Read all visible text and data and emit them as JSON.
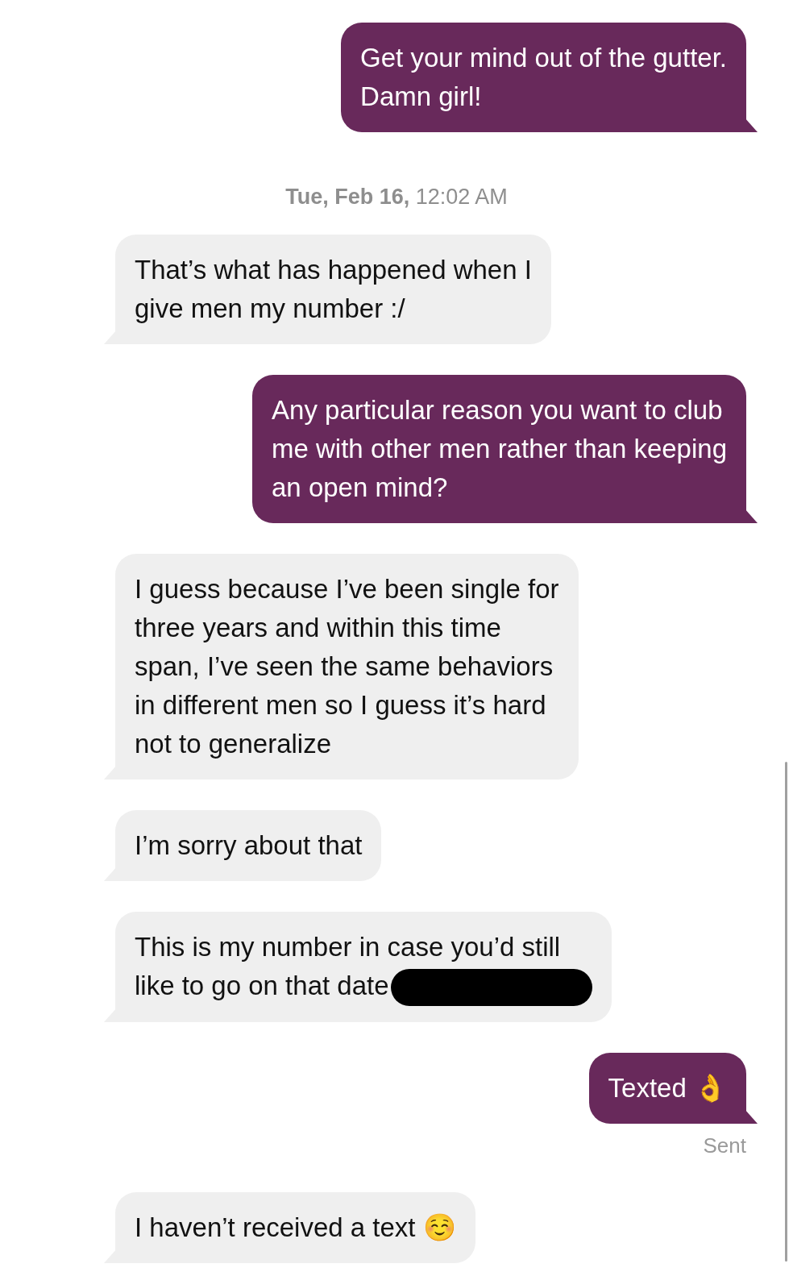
{
  "messages": [
    {
      "kind": "sent",
      "text": "Get your mind out of the gutter.\nDamn girl!"
    },
    {
      "kind": "timestamp",
      "text": "**Tue, Feb 16,** 12:02 AM"
    },
    {
      "kind": "received",
      "text": " That’s what has happened when I\ngive men my number :/"
    },
    {
      "kind": "sent",
      "text": "Any particular reason you want to club\nme with other men rather than keeping\nan open mind?"
    },
    {
      "kind": "received",
      "text": "I guess because I’ve been single for\nthree years and within this time\nspan, I’ve seen the same behaviors\nin different men so I guess it’s hard\nnot to generalize"
    },
    {
      "kind": "received",
      "text": "I’m sorry about that"
    },
    {
      "kind": "received",
      "text": "This is my number in case you’d still\nlike to go on that date",
      "redacted": true
    },
    {
      "kind": "sent",
      "text": "Texted 👌"
    },
    {
      "kind": "status",
      "text": "Sent"
    },
    {
      "kind": "received",
      "text": "I haven’t received a text ☺️"
    }
  ]
}
